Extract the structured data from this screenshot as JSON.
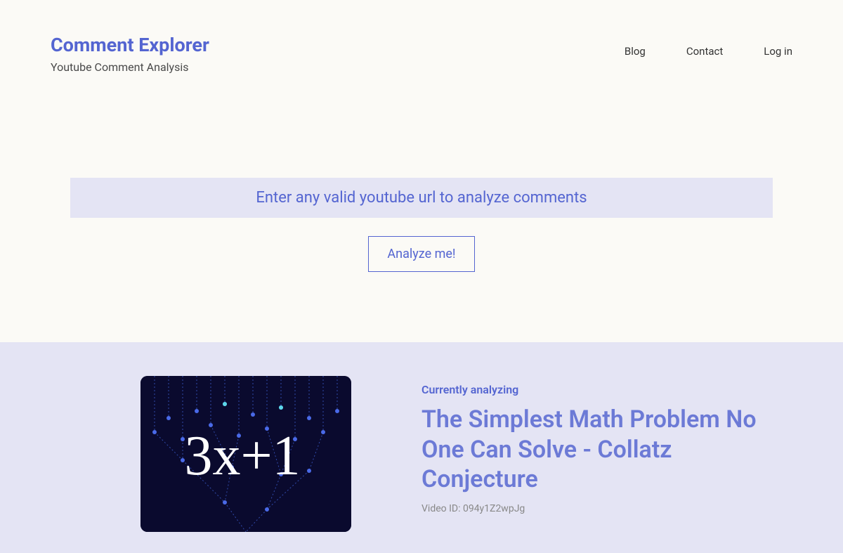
{
  "header": {
    "logo_title": "Comment Explorer",
    "logo_subtitle": "Youtube Comment Analysis",
    "nav": {
      "blog": "Blog",
      "contact": "Contact",
      "login": "Log in"
    }
  },
  "search": {
    "placeholder": "Enter any valid youtube url to analyze comments",
    "button_label": "Analyze me!"
  },
  "analyzing": {
    "label": "Currently analyzing",
    "title": "The Simplest Math Problem No One Can Solve - Collatz Conjecture",
    "video_id_label": "Video ID: 094y1Z2wpJg",
    "thumbnail_text": "3x+1"
  }
}
